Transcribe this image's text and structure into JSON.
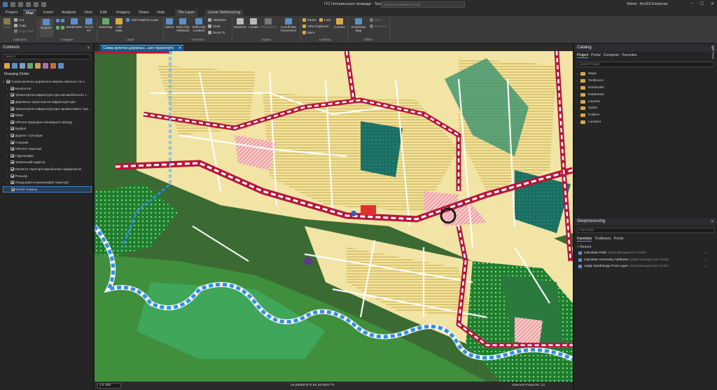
{
  "window": {
    "title": "ГІС Нетішинської громади - Транспорт",
    "search_placeholder": "Command Search (Alt+Q)",
    "user": "Admin - ArcGIS Enterprise",
    "controls": {
      "minimize": "–",
      "maximize": "☐",
      "close": "✕"
    }
  },
  "ribbon_tabs": [
    {
      "label": "Project"
    },
    {
      "label": "Map"
    },
    {
      "label": "Insert"
    },
    {
      "label": "Analysis"
    },
    {
      "label": "View"
    },
    {
      "label": "Edit"
    },
    {
      "label": "Imagery"
    },
    {
      "label": "Share"
    },
    {
      "label": "Help"
    },
    {
      "label": "Tile Layer"
    },
    {
      "label": "Linear Referencing"
    }
  ],
  "ribbon": {
    "paste": "Paste",
    "cut": "Cut",
    "copy": "Copy",
    "copy_path": "Copy Path",
    "explore": "Explore",
    "bookmarks": "Bookmarks",
    "go_to_xy": "Go To XY",
    "basemap": "Basemap",
    "add_data": "Add Data",
    "add_graphics_layer": "Add Graphics Layer",
    "select": "Select",
    "select_by_attributes": "Select By Attributes",
    "select_by_location": "Select By Location",
    "attributes": "Attributes",
    "clear": "Clear",
    "zoom_to": "Zoom To",
    "measure": "Measure",
    "locate": "Locate",
    "infographics": "Infographics",
    "coordinate_conversion": "Coordinate Conversion",
    "pause": "Pause",
    "lock": "Lock",
    "view_unplaced": "View Unplaced",
    "more": "More",
    "convert": "Convert",
    "download_map": "Download Map",
    "sync": "Sync",
    "remove": "Remove",
    "groups": {
      "clipboard": "Clipboard",
      "navigate": "Navigate",
      "layer": "Layer",
      "selection": "Selection",
      "inquiry": "Inquiry",
      "labeling": "Labeling",
      "offline": "Offline"
    }
  },
  "contents": {
    "title": "Contents",
    "search_placeholder": "Search",
    "drawing_order": "Drawing Order",
    "layers": [
      {
        "label": "Схема вулично-дорожньої мережі, міського та з...",
        "checked": true,
        "root": true
      },
      {
        "label": "Безпілотні",
        "checked": true
      },
      {
        "label": "Транспортна інфраструктура автомобільного т...",
        "checked": true
      },
      {
        "label": "Дорожньо-транспортна інфраструктура",
        "checked": true
      },
      {
        "label": "Транспортна інфраструктура промислового тра...",
        "checked": true
      },
      {
        "label": "Межі",
        "checked": true
      },
      {
        "label": "Об'єкти природно-заповідного фонду",
        "checked": true
      },
      {
        "label": "Будівлі",
        "checked": true
      },
      {
        "label": "Дороги і тротуари",
        "checked": true
      },
      {
        "label": "Струмки",
        "checked": true
      },
      {
        "label": "Об'єкти території",
        "checked": true
      },
      {
        "label": "Гідрографія",
        "checked": true
      },
      {
        "label": "Земельний кадастр",
        "checked": true
      },
      {
        "label": "Проекти території виробничих підприємств",
        "checked": true
      },
      {
        "label": "Рельєф",
        "checked": true
      },
      {
        "label": "Ландшафтно-рекреаційні території",
        "checked": true
      },
      {
        "label": "World Imagery",
        "checked": true,
        "selected": true
      }
    ]
  },
  "map": {
    "tab_label": "Схема вулично-дорожньо...ього транспорту",
    "scale": "1:6 398",
    "coordinates": "26,6909878°E 50,3476637°N",
    "selected_features": "Selected Features: 13"
  },
  "catalog": {
    "title": "Catalog",
    "tabs": [
      "Project",
      "Portal",
      "Computer",
      "Favorites"
    ],
    "search_placeholder": "Search Project",
    "items": [
      "Maps",
      "Toolboxes",
      "Notebooks",
      "Databases",
      "Layouts",
      "Styles",
      "Folders",
      "Locators"
    ]
  },
  "geoprocessing": {
    "title": "Geoprocessing",
    "search_placeholder": "Find Tools",
    "tabs": [
      "Favorites",
      "Toolboxes",
      "Portal"
    ],
    "recent_label": "Recent",
    "tools": [
      {
        "name": "Calculate Field",
        "toolbox": "(Data Management Tools)"
      },
      {
        "name": "Calculate Geometry Attributes",
        "toolbox": "(Data Management Tools)"
      },
      {
        "name": "Apply Symbology From Layer",
        "toolbox": "(Data Management Tools)"
      }
    ]
  },
  "side_strip_label": "Edit Pane"
}
